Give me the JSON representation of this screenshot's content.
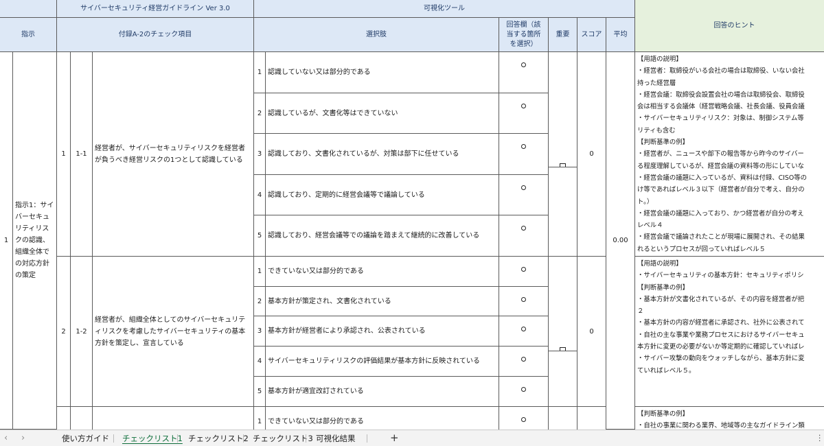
{
  "header": {
    "guideline": "サイバーセキュリティ経営ガイドライン Ver 3.0",
    "tool": "可視化ツール",
    "directive": "指示",
    "check_item": "付録A-2のチェック項目",
    "options": "選択肢",
    "answer": "回答欄（該当する箇所を選択）",
    "importance": "重要",
    "score": "スコア",
    "average": "平均",
    "hint": "回答のヒント"
  },
  "directive": {
    "no": "1",
    "text": "指示1：サイバーセキュリティリスクの認識、組織全体での対応方針の策定",
    "average": "0.00"
  },
  "items": [
    {
      "group": "1",
      "code": "1-1",
      "text": "経営者が、サイバーセキュリティリスクを経営者が負うべき経営リスクの1つとして認識している",
      "score": "0",
      "options": [
        {
          "n": "1",
          "text": "認識していない又は部分的である",
          "mark": "○"
        },
        {
          "n": "2",
          "text": "認識しているが、文書化等はできていない",
          "mark": "○"
        },
        {
          "n": "3",
          "text": "認識しており、文書化されているが、対策は部下に任せている",
          "mark": "○"
        },
        {
          "n": "4",
          "text": "認識しており、定期的に経営会議等で議論している",
          "mark": "○"
        },
        {
          "n": "5",
          "text": "認識しており、経営会議等での議論を踏まえて継続的に改善している",
          "mark": "○"
        }
      ],
      "hint": [
        "【用語の説明】",
        "・経営者：取締役がいる会社の場合は取締役、いない会社",
        "持った経営層",
        "・経営会議：取締役会設置会社の場合は取締役会、取締役",
        "会は相当する会議体（経営戦略会議、社長会議、役員会議",
        "・サイバーセキュリティリスク：対象は、制御システム等",
        "リティも含む",
        "【判断基準の例】",
        "・経営者が、ニュースや部下の報告等から昨今のサイバー",
        "る程度理解しているが、経営会議の資料等の形にしていな",
        "・経営会議の議題に入っているが、資料は付録、CISO等の",
        "け等であればレベル３以下（経営者が自分で考え、自分の",
        "ト。）",
        "・経営会議の議題に入っており、かつ経営者が自分の考え",
        "レベル４",
        "・経営会議で議論されたことが現場に展開され、その結果",
        "れるというプロセスが回っていればレベル５"
      ]
    },
    {
      "group": "2",
      "code": "1-2",
      "text": "経営者が、組織全体としてのサイバーセキュリティリスクを考慮したサイバーセキュリティの基本方針を策定し、宣言している",
      "score": "0",
      "options": [
        {
          "n": "1",
          "text": "できていない又は部分的である",
          "mark": "○"
        },
        {
          "n": "2",
          "text": "基本方針が策定され、文書化されている",
          "mark": "○"
        },
        {
          "n": "3",
          "text": "基本方針が経営者により承認され、公表されている",
          "mark": "○"
        },
        {
          "n": "4",
          "text": "サイバーセキュリティリスクの評価結果が基本方針に反映されている",
          "mark": "○"
        },
        {
          "n": "5",
          "text": "基本方針が適宜改訂されている",
          "mark": "○"
        }
      ],
      "hint": [
        "【用語の説明】",
        "・サイバーセキュリティの基本方針：セキュリティポリシ",
        "【判断基準の例】",
        "・基本方針が文書化されているが、その内容を経営者が把",
        "２",
        "・基本方針の内容が経営者に承認され、社外に公表されて",
        "・自社の主な事業や業務プロセスにおけるサイバーセキュ",
        "本方針に変更の必要がないか等定期的に確認していればレ",
        "・サイバー攻撃の動向をウォッチしながら、基本方針に変",
        "ていればレベル５。"
      ]
    },
    {
      "group": "",
      "code": "",
      "text": "",
      "options": [
        {
          "n": "1",
          "text": "できていない又は部分的である",
          "mark": "○"
        }
      ],
      "hint": [
        "【判断基準の例】",
        "・自社の事業に関わる業界、地域等の主なガイドライン類"
      ]
    }
  ],
  "importance_mark": "□",
  "tabs": [
    {
      "label": "使い方ガイド",
      "active": false
    },
    {
      "label": "チェックリスト1",
      "active": true
    },
    {
      "label": "チェックリスト2",
      "active": false
    },
    {
      "label": "チェックリスト3",
      "active": false
    },
    {
      "label": "可視化結果",
      "active": false
    }
  ],
  "tabbar": {
    "prev": "‹",
    "next": "›",
    "add": "+",
    "more": "⋮"
  }
}
